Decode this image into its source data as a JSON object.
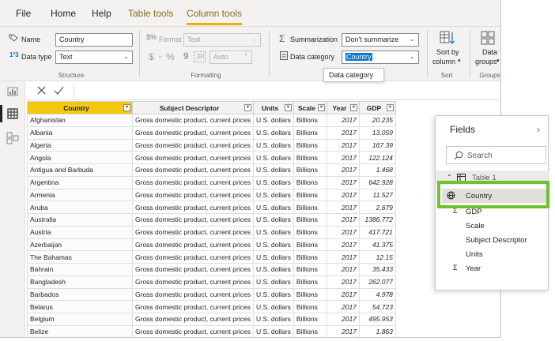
{
  "tabs": [
    {
      "label": "File"
    },
    {
      "label": "Home"
    },
    {
      "label": "Help"
    },
    {
      "label": "Table tools"
    },
    {
      "label": "Column tools"
    }
  ],
  "ribbon": {
    "structure": {
      "name_label": "Name",
      "name_value": "Country",
      "datatype_label": "Data type",
      "datatype_value": "Text",
      "group_label": "Structure"
    },
    "formatting": {
      "format_label": "Format",
      "format_value": "Text",
      "dollar": "$",
      "percent": "%",
      "comma": "9",
      "auto_value": "Auto",
      "group_label": "Formatting"
    },
    "properties": {
      "summarization_label": "Summarization",
      "summarization_value": "Don't summarize",
      "category_label": "Data category",
      "category_value": "Country"
    },
    "sort": {
      "label_line1": "Sort by",
      "label_line2": "column",
      "group_label": "Sort"
    },
    "groups": {
      "label_line1": "Data",
      "label_line2": "groups",
      "group_label": "Groups"
    },
    "tooltip": "Data category"
  },
  "table": {
    "columns": [
      "Country",
      "Subject Descriptor",
      "Units",
      "Scale",
      "Year",
      "GDP"
    ],
    "rows": [
      [
        "Afghanistan",
        "Gross domestic product, current prices",
        "U.S. dollars",
        "Billions",
        "2017",
        "20.235"
      ],
      [
        "Albania",
        "Gross domestic product, current prices",
        "U.S. dollars",
        "Billions",
        "2017",
        "13.059"
      ],
      [
        "Algeria",
        "Gross domestic product, current prices",
        "U.S. dollars",
        "Billions",
        "2017",
        "167.39"
      ],
      [
        "Angola",
        "Gross domestic product, current prices",
        "U.S. dollars",
        "Billions",
        "2017",
        "122.124"
      ],
      [
        "Antigua and Barbuda",
        "Gross domestic product, current prices",
        "U.S. dollars",
        "Billions",
        "2017",
        "1.468"
      ],
      [
        "Argentina",
        "Gross domestic product, current prices",
        "U.S. dollars",
        "Billions",
        "2017",
        "642.928"
      ],
      [
        "Armenia",
        "Gross domestic product, current prices",
        "U.S. dollars",
        "Billions",
        "2017",
        "11.527"
      ],
      [
        "Aruba",
        "Gross domestic product, current prices",
        "U.S. dollars",
        "Billions",
        "2017",
        "2.679"
      ],
      [
        "Australia",
        "Gross domestic product, current prices",
        "U.S. dollars",
        "Billions",
        "2017",
        "1386.772"
      ],
      [
        "Austria",
        "Gross domestic product, current prices",
        "U.S. dollars",
        "Billions",
        "2017",
        "417.721"
      ],
      [
        "Azerbaijan",
        "Gross domestic product, current prices",
        "U.S. dollars",
        "Billions",
        "2017",
        "41.375"
      ],
      [
        "The Bahamas",
        "Gross domestic product, current prices",
        "U.S. dollars",
        "Billions",
        "2017",
        "12.15"
      ],
      [
        "Bahrain",
        "Gross domestic product, current prices",
        "U.S. dollars",
        "Billions",
        "2017",
        "35.433"
      ],
      [
        "Bangladesh",
        "Gross domestic product, current prices",
        "U.S. dollars",
        "Billions",
        "2017",
        "262.077"
      ],
      [
        "Barbados",
        "Gross domestic product, current prices",
        "U.S. dollars",
        "Billions",
        "2017",
        "4.978"
      ],
      [
        "Belarus",
        "Gross domestic product, current prices",
        "U.S. dollars",
        "Billions",
        "2017",
        "54.723"
      ],
      [
        "Belgium",
        "Gross domestic product, current prices",
        "U.S. dollars",
        "Billions",
        "2017",
        "495.953"
      ],
      [
        "Belize",
        "Gross domestic product, current prices",
        "U.S. dollars",
        "Billions",
        "2017",
        "1.863"
      ]
    ]
  },
  "fields_pane": {
    "title": "Fields",
    "search_placeholder": "Search",
    "table_name": "Table 1",
    "items": [
      {
        "label": "Country",
        "icon": "globe-icon"
      },
      {
        "label": "GDP",
        "icon": "sigma-icon"
      },
      {
        "label": "Scale",
        "icon": ""
      },
      {
        "label": "Subject Descriptor",
        "icon": ""
      },
      {
        "label": "Units",
        "icon": ""
      },
      {
        "label": "Year",
        "icon": "sigma-icon"
      }
    ]
  }
}
